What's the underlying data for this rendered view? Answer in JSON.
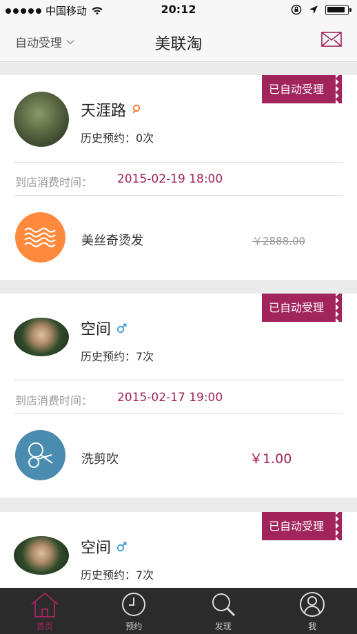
{
  "status_bar": {
    "carrier": "中国移动",
    "time": "20:12"
  },
  "nav": {
    "filter_label": "自动受理",
    "title": "美联淘"
  },
  "orders": [
    {
      "status": "已自动受理",
      "user_name": "天涯路",
      "gender": "female",
      "history": "历史预约：0次",
      "visit_label": "到店消费时间：",
      "visit_time": "2015-02-19 18:00",
      "service_name": "美丝奇烫发",
      "service_icon": "wave-icon",
      "service_icon_color": "#ff8a3d",
      "price": "￥2888.00",
      "price_struck": true
    },
    {
      "status": "已自动受理",
      "user_name": "空间",
      "gender": "male",
      "history": "历史预约：7次",
      "visit_label": "到店消费时间：",
      "visit_time": "2015-02-17 19:00",
      "service_name": "洗剪吹",
      "service_icon": "scissors-icon",
      "service_icon_color": "#4a8bb0",
      "price": "￥1.00",
      "price_struck": false
    },
    {
      "status": "已自动受理",
      "user_name": "空间",
      "gender": "male",
      "history": "历史预约：7次"
    }
  ],
  "tabs": [
    {
      "label": "首页",
      "icon": "home-icon",
      "active": true
    },
    {
      "label": "预约",
      "icon": "clock-icon",
      "active": false
    },
    {
      "label": "发现",
      "icon": "search-icon",
      "active": false
    },
    {
      "label": "我",
      "icon": "user-icon",
      "active": false
    }
  ],
  "colors": {
    "accent": "#a1245b",
    "tab_bar": "#2b2b2b"
  }
}
